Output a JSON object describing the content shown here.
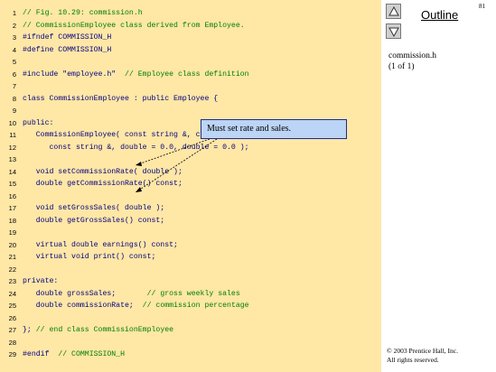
{
  "slide": {
    "page_number": "81",
    "outline_title": "Outline",
    "file_name": "commission.h",
    "page_count": "(1 of 1)",
    "copyright_line1": "© 2003 Prentice Hall, Inc.",
    "copyright_line2": "All rights reserved.",
    "callout_text": "Must set rate and sales."
  },
  "nav": {
    "up_icon": "triangle-up-icon",
    "down_icon": "triangle-down-icon"
  },
  "colors": {
    "code_background": "#ffe7a6",
    "callout_fill": "#bcd4f5",
    "comment": "#008000",
    "code_text": "#000080"
  },
  "code_lines": [
    {
      "num": "1",
      "text": "// Fig. 10.29: commission.h"
    },
    {
      "num": "2",
      "text": "// CommissionEmployee class derived from Employee."
    },
    {
      "num": "3",
      "text": "#ifndef COMMISSION_H"
    },
    {
      "num": "4",
      "text": "#define COMMISSION_H"
    },
    {
      "num": "5",
      "text": ""
    },
    {
      "num": "6",
      "text": "#include \"employee.h\"  // Employee class definition"
    },
    {
      "num": "7",
      "text": ""
    },
    {
      "num": "8",
      "text": "class CommissionEmployee : public Employee {"
    },
    {
      "num": "9",
      "text": ""
    },
    {
      "num": "10",
      "text": "public:"
    },
    {
      "num": "11",
      "text": "   CommissionEmployee( const string &, const string &,"
    },
    {
      "num": "12",
      "text": "      const string &, double = 0.0, double = 0.0 );"
    },
    {
      "num": "13",
      "text": ""
    },
    {
      "num": "14",
      "text": "   void setCommissionRate( double );"
    },
    {
      "num": "15",
      "text": "   double getCommissionRate() const;"
    },
    {
      "num": "16",
      "text": ""
    },
    {
      "num": "17",
      "text": "   void setGrossSales( double );"
    },
    {
      "num": "18",
      "text": "   double getGrossSales() const;"
    },
    {
      "num": "19",
      "text": ""
    },
    {
      "num": "20",
      "text": "   virtual double earnings() const;"
    },
    {
      "num": "21",
      "text": "   virtual void print() const;"
    },
    {
      "num": "22",
      "text": ""
    },
    {
      "num": "23",
      "text": "private:"
    },
    {
      "num": "24",
      "text": "   double grossSales;       // gross weekly sales"
    },
    {
      "num": "25",
      "text": "   double commissionRate;  // commission percentage"
    },
    {
      "num": "26",
      "text": ""
    },
    {
      "num": "27",
      "text": "}; // end class CommissionEmployee"
    },
    {
      "num": "28",
      "text": ""
    },
    {
      "num": "29",
      "text": "#endif  // COMMISSION_H"
    }
  ]
}
